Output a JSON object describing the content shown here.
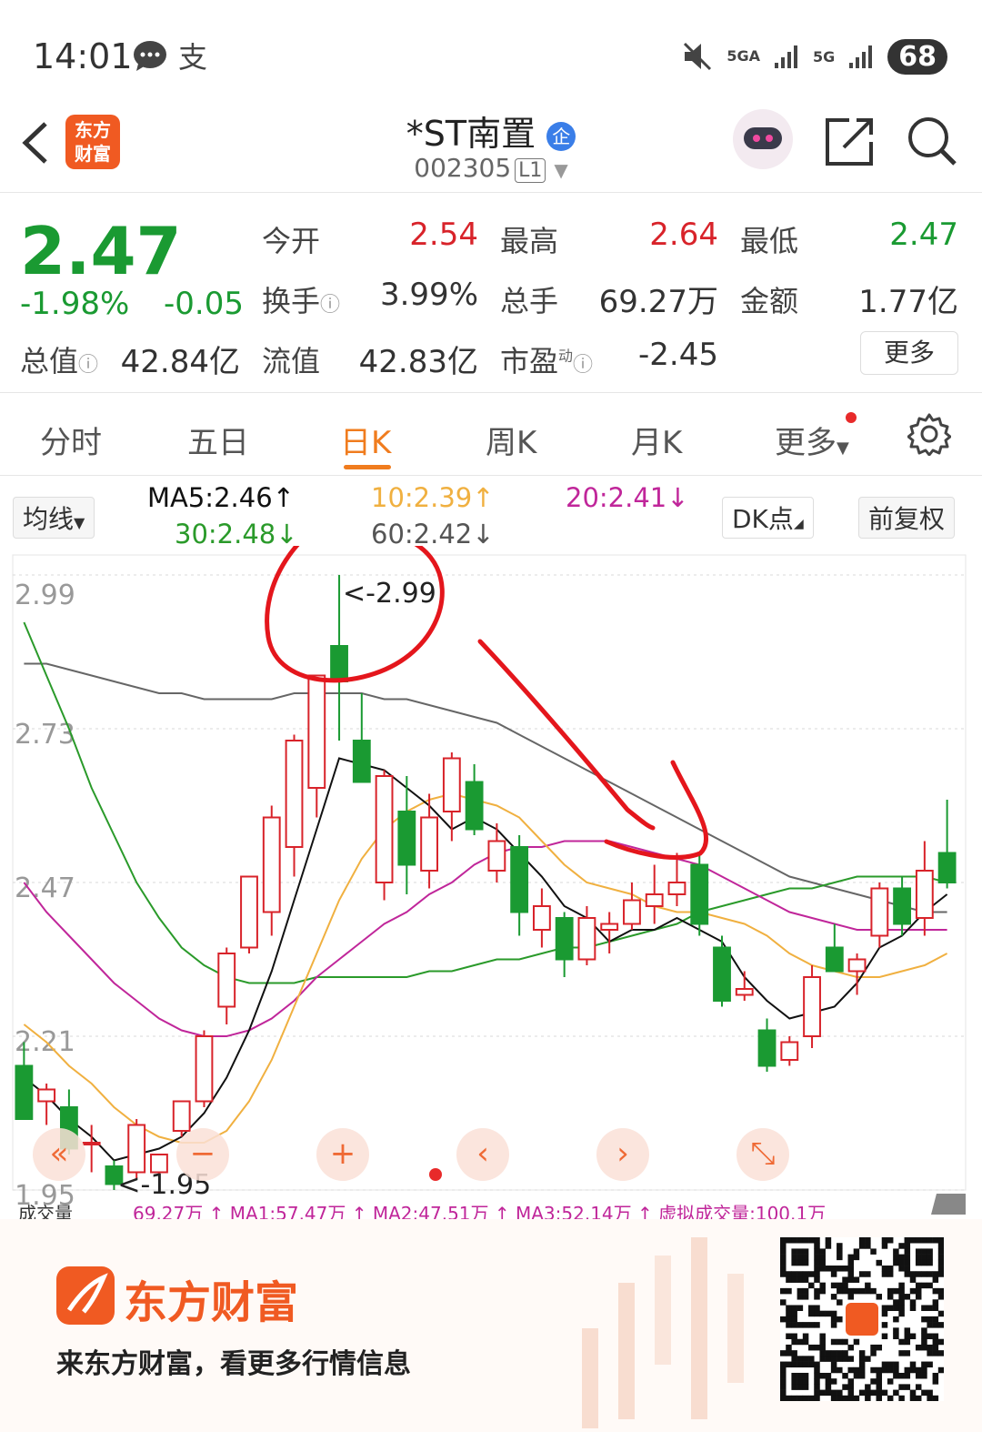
{
  "status_bar": {
    "time": "14:01",
    "battery": "68",
    "network_1": "5GA",
    "network_2": "5G",
    "icons": [
      "message-icon",
      "alipay-icon",
      "mute-icon",
      "signal-icon",
      "battery-icon"
    ]
  },
  "nav": {
    "logo_text_1": "东方",
    "logo_text_2": "财富",
    "title": "*ST南置",
    "badge": "企",
    "code": "002305",
    "level": "L1"
  },
  "quote": {
    "price": "2.47",
    "change_pct": "-1.98%",
    "change": "-0.05",
    "open_label": "今开",
    "open": "2.54",
    "high_label": "最高",
    "high": "2.64",
    "low_label": "最低",
    "low": "2.47",
    "turnover_label": "换手",
    "turnover": "3.99%",
    "volume_label": "总手",
    "volume": "69.27万",
    "amount_label": "金额",
    "amount": "1.77亿",
    "mcap_label": "总值",
    "mcap": "42.84亿",
    "float_label": "流值",
    "float": "42.83亿",
    "pe_label": "市盈",
    "pe_sup": "动",
    "pe": "-2.45",
    "more": "更多"
  },
  "tabs": [
    "分时",
    "五日",
    "日K",
    "周K",
    "月K",
    "更多"
  ],
  "active_tab": "日K",
  "indicators": {
    "selector": "均线",
    "ma5": "MA5:2.46↑",
    "ma10": "10:2.39↑",
    "ma20": "20:2.41↓",
    "ma30": "30:2.48↓",
    "ma60": "60:2.42↓",
    "dk": "DK点",
    "adjust": "前复权"
  },
  "colors": {
    "up": "#d8232a",
    "down": "#1a9a32",
    "ma5": "#111111",
    "ma10": "#f0b040",
    "ma20": "#c0269a",
    "ma30": "#2a9a2a",
    "ma60": "#666666",
    "accent": "#f07c1e"
  },
  "chart_data": {
    "type": "candlestick",
    "y_ticks": [
      "2.99",
      "2.73",
      "2.47",
      "2.21",
      "1.95"
    ],
    "ylim": [
      1.95,
      2.99
    ],
    "max_label": "<-2.99",
    "min_label": "<-1.95",
    "candles": [
      {
        "o": 2.16,
        "h": 2.2,
        "l": 2.07,
        "c": 2.07
      },
      {
        "o": 2.1,
        "h": 2.13,
        "l": 2.06,
        "c": 2.12
      },
      {
        "o": 2.09,
        "h": 2.12,
        "l": 2.01,
        "c": 2.02
      },
      {
        "o": 2.03,
        "h": 2.06,
        "l": 1.98,
        "c": 2.03
      },
      {
        "o": 1.99,
        "h": 2.0,
        "l": 1.95,
        "c": 1.96
      },
      {
        "o": 1.98,
        "h": 2.07,
        "l": 1.97,
        "c": 2.06
      },
      {
        "o": 1.98,
        "h": 2.01,
        "l": 1.97,
        "c": 2.01
      },
      {
        "o": 2.05,
        "h": 2.1,
        "l": 2.04,
        "c": 2.1
      },
      {
        "o": 2.1,
        "h": 2.22,
        "l": 2.09,
        "c": 2.21
      },
      {
        "o": 2.26,
        "h": 2.36,
        "l": 2.23,
        "c": 2.35
      },
      {
        "o": 2.36,
        "h": 2.48,
        "l": 2.35,
        "c": 2.48
      },
      {
        "o": 2.42,
        "h": 2.6,
        "l": 2.38,
        "c": 2.58
      },
      {
        "o": 2.53,
        "h": 2.72,
        "l": 2.48,
        "c": 2.71
      },
      {
        "o": 2.63,
        "h": 2.82,
        "l": 2.58,
        "c": 2.82
      },
      {
        "o": 2.87,
        "h": 2.99,
        "l": 2.71,
        "c": 2.81
      },
      {
        "o": 2.71,
        "h": 2.79,
        "l": 2.65,
        "c": 2.64
      },
      {
        "o": 2.47,
        "h": 2.66,
        "l": 2.44,
        "c": 2.65
      },
      {
        "o": 2.59,
        "h": 2.65,
        "l": 2.45,
        "c": 2.5
      },
      {
        "o": 2.49,
        "h": 2.62,
        "l": 2.46,
        "c": 2.58
      },
      {
        "o": 2.59,
        "h": 2.69,
        "l": 2.54,
        "c": 2.68
      },
      {
        "o": 2.64,
        "h": 2.67,
        "l": 2.55,
        "c": 2.56
      },
      {
        "o": 2.49,
        "h": 2.57,
        "l": 2.47,
        "c": 2.54
      },
      {
        "o": 2.53,
        "h": 2.55,
        "l": 2.38,
        "c": 2.42
      },
      {
        "o": 2.39,
        "h": 2.46,
        "l": 2.36,
        "c": 2.43
      },
      {
        "o": 2.41,
        "h": 2.42,
        "l": 2.31,
        "c": 2.34
      },
      {
        "o": 2.34,
        "h": 2.43,
        "l": 2.33,
        "c": 2.41
      },
      {
        "o": 2.39,
        "h": 2.42,
        "l": 2.35,
        "c": 2.4
      },
      {
        "o": 2.4,
        "h": 2.47,
        "l": 2.39,
        "c": 2.44
      },
      {
        "o": 2.43,
        "h": 2.5,
        "l": 2.4,
        "c": 2.45
      },
      {
        "o": 2.45,
        "h": 2.52,
        "l": 2.43,
        "c": 2.47
      },
      {
        "o": 2.5,
        "h": 2.52,
        "l": 2.38,
        "c": 2.4
      },
      {
        "o": 2.36,
        "h": 2.38,
        "l": 2.26,
        "c": 2.27
      },
      {
        "o": 2.28,
        "h": 2.32,
        "l": 2.27,
        "c": 2.29
      },
      {
        "o": 2.22,
        "h": 2.24,
        "l": 2.15,
        "c": 2.16
      },
      {
        "o": 2.17,
        "h": 2.21,
        "l": 2.16,
        "c": 2.2
      },
      {
        "o": 2.21,
        "h": 2.33,
        "l": 2.19,
        "c": 2.31
      },
      {
        "o": 2.36,
        "h": 2.4,
        "l": 2.32,
        "c": 2.32
      },
      {
        "o": 2.32,
        "h": 2.35,
        "l": 2.28,
        "c": 2.34
      },
      {
        "o": 2.38,
        "h": 2.47,
        "l": 2.36,
        "c": 2.46
      },
      {
        "o": 2.46,
        "h": 2.48,
        "l": 2.38,
        "c": 2.4
      },
      {
        "o": 2.41,
        "h": 2.54,
        "l": 2.38,
        "c": 2.49
      },
      {
        "o": 2.52,
        "h": 2.61,
        "l": 2.46,
        "c": 2.47
      }
    ],
    "ma5": [
      2.14,
      2.11,
      2.07,
      2.04,
      2.0,
      2.01,
      2.02,
      2.04,
      2.08,
      2.14,
      2.22,
      2.32,
      2.44,
      2.56,
      2.68,
      2.67,
      2.66,
      2.63,
      2.6,
      2.56,
      2.58,
      2.56,
      2.52,
      2.48,
      2.43,
      2.41,
      2.37,
      2.39,
      2.39,
      2.41,
      2.39,
      2.37,
      2.31,
      2.27,
      2.24,
      2.25,
      2.26,
      2.3,
      2.36,
      2.38,
      2.42,
      2.45
    ],
    "ma10": [
      2.23,
      2.2,
      2.16,
      2.13,
      2.09,
      2.06,
      2.04,
      2.03,
      2.03,
      2.05,
      2.1,
      2.17,
      2.26,
      2.35,
      2.44,
      2.51,
      2.56,
      2.59,
      2.61,
      2.62,
      2.61,
      2.6,
      2.58,
      2.54,
      2.5,
      2.47,
      2.46,
      2.45,
      2.43,
      2.42,
      2.42,
      2.41,
      2.4,
      2.38,
      2.35,
      2.33,
      2.32,
      2.31,
      2.31,
      2.32,
      2.33,
      2.35
    ],
    "ma20": [
      2.47,
      2.42,
      2.38,
      2.34,
      2.3,
      2.27,
      2.24,
      2.22,
      2.21,
      2.21,
      2.22,
      2.24,
      2.27,
      2.31,
      2.34,
      2.37,
      2.4,
      2.42,
      2.45,
      2.47,
      2.5,
      2.52,
      2.53,
      2.53,
      2.54,
      2.54,
      2.54,
      2.53,
      2.52,
      2.51,
      2.5,
      2.48,
      2.46,
      2.44,
      2.42,
      2.41,
      2.4,
      2.39,
      2.39,
      2.39,
      2.39,
      2.39
    ],
    "ma30": [
      2.91,
      2.82,
      2.73,
      2.63,
      2.55,
      2.47,
      2.41,
      2.36,
      2.33,
      2.31,
      2.3,
      2.3,
      2.3,
      2.31,
      2.31,
      2.31,
      2.31,
      2.31,
      2.32,
      2.32,
      2.33,
      2.34,
      2.34,
      2.35,
      2.36,
      2.36,
      2.37,
      2.38,
      2.39,
      2.4,
      2.42,
      2.43,
      2.44,
      2.45,
      2.46,
      2.46,
      2.47,
      2.48,
      2.48,
      2.48,
      2.48,
      2.47
    ],
    "ma60": [
      2.84,
      2.84,
      2.83,
      2.82,
      2.81,
      2.8,
      2.79,
      2.79,
      2.78,
      2.78,
      2.78,
      2.78,
      2.79,
      2.79,
      2.79,
      2.79,
      2.78,
      2.78,
      2.77,
      2.76,
      2.75,
      2.74,
      2.72,
      2.7,
      2.68,
      2.66,
      2.64,
      2.62,
      2.6,
      2.58,
      2.56,
      2.54,
      2.52,
      2.5,
      2.48,
      2.47,
      2.46,
      2.45,
      2.44,
      2.43,
      2.42,
      2.42
    ]
  },
  "chart_controls": [
    "«",
    "−",
    "+",
    "‹",
    "›",
    "⤡"
  ],
  "volume_strip": {
    "label": "成交量",
    "text": "69.27万 ↑ MA1:57.47万 ↑ MA2:47.51万 ↑ MA3:52.14万 ↑ 虚拟成交量:100.1万"
  },
  "banner": {
    "brand": "东方财富",
    "slogan": "来东方财富，看更多行情信息"
  }
}
